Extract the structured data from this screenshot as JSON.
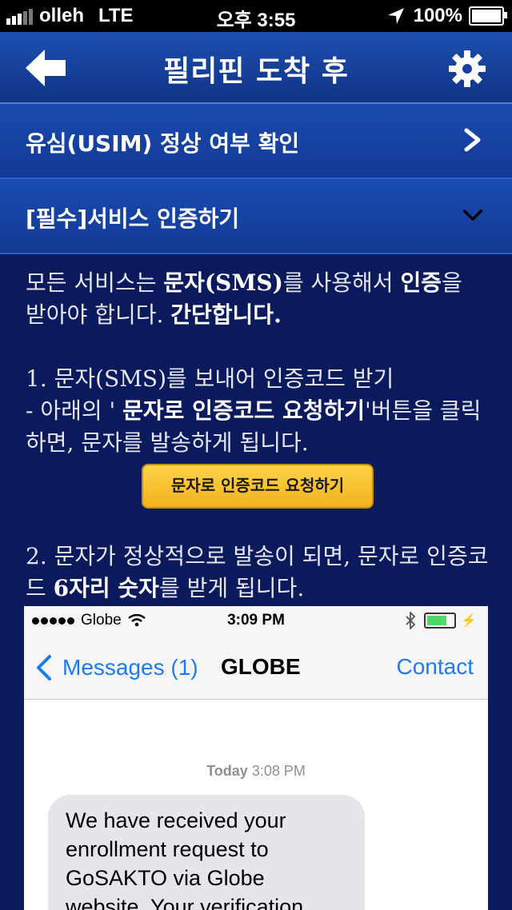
{
  "status_bar": {
    "carrier": "olleh",
    "network": "LTE",
    "time": "오후 3:55",
    "battery": "100%"
  },
  "navbar": {
    "title": "필리핀 도착 후"
  },
  "menu": [
    {
      "label": "유심(USIM) 정상 여부 확인",
      "state": "collapsed"
    },
    {
      "label": "[필수]서비스 인증하기",
      "state": "expanded"
    }
  ],
  "content": {
    "intro_1": "모든 서비스는 ",
    "intro_bold_1": "문자(SMS)",
    "intro_2": "를 사용해서 ",
    "intro_bold_2": "인증",
    "intro_3": "을 받아야 합니다. ",
    "intro_bold_3": "간단합니다.",
    "step1_title": "1. 문자(SMS)를 보내어 인증코드 받기",
    "step1_pre": "  - 아래의 ' ",
    "step1_bold": "문자로 인증코드 요청하기",
    "step1_post": "'버튼을 클릭하면, 문자를 발송하게 됩니다.",
    "request_button": "문자로 인증코드 요청하기",
    "step2_pre": "2. 문자가 정상적으로 발송이 되면, 문자로 인증코드 ",
    "step2_bold": "6자리 숫자",
    "step2_post": "를 받게 됩니다."
  },
  "screenshot": {
    "carrier": "Globe",
    "time": "3:09 PM",
    "back_label": "Messages (1)",
    "title": "GLOBE",
    "contact": "Contact",
    "date_bold": "Today",
    "date_time": "3:08 PM",
    "message": "We have received your enrollment request to GoSAKTO via Globe website. Your verification"
  },
  "colors": {
    "background": "#0b1a5c",
    "navbar": "#1d4fb0",
    "button": "#f6c12f",
    "ios_blue": "#1a7cf5"
  }
}
